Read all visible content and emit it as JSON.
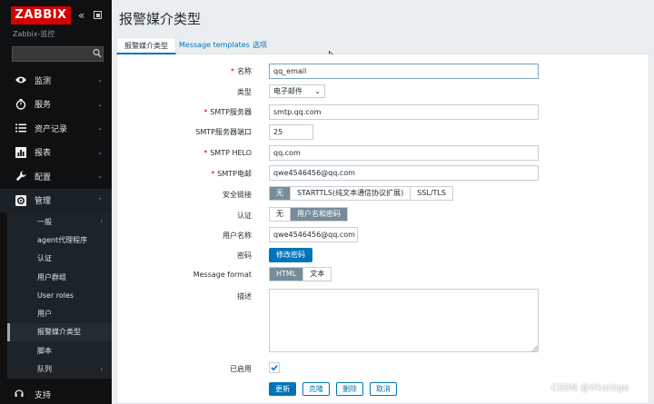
{
  "sidebar": {
    "logo": "ZABBIX",
    "subtitle": "Zabbix-监控",
    "search": {
      "value": "",
      "placeholder": ""
    },
    "items": [
      {
        "label": "监测",
        "icon": "eye-icon"
      },
      {
        "label": "服务",
        "icon": "clock-icon"
      },
      {
        "label": "资产记录",
        "icon": "list-icon"
      },
      {
        "label": "报表",
        "icon": "bar-chart-icon"
      },
      {
        "label": "配置",
        "icon": "wrench-icon"
      },
      {
        "label": "管理",
        "icon": "gear-icon"
      }
    ],
    "admin_items": [
      {
        "label": "一般"
      },
      {
        "label": "agent代理程序"
      },
      {
        "label": "认证"
      },
      {
        "label": "用户群组"
      },
      {
        "label": "User roles"
      },
      {
        "label": "用户"
      },
      {
        "label": "报警媒介类型"
      },
      {
        "label": "脚本"
      },
      {
        "label": "队列"
      }
    ],
    "support": "支持"
  },
  "header": {
    "title": "报警媒介类型"
  },
  "tabs": [
    {
      "label": "报警媒介类型"
    },
    {
      "label": "Message templates"
    },
    {
      "label": "选项"
    }
  ],
  "form": {
    "name": {
      "label": "名称",
      "value": "qq_email"
    },
    "type": {
      "label": "类型",
      "value": "电子邮件"
    },
    "smtp_server": {
      "label": "SMTP服务器",
      "value": "smtp.qq.com"
    },
    "smtp_port": {
      "label": "SMTP服务器端口",
      "value": "25"
    },
    "smtp_helo": {
      "label": "SMTP HELO",
      "value": "qq.com"
    },
    "smtp_email": {
      "label": "SMTP电邮",
      "value": "qwe4546456@qq.com"
    },
    "security": {
      "label": "安全链接",
      "options": [
        "无",
        "STARTTLS(纯文本通信协议扩展)",
        "SSL/TLS"
      ],
      "selected": "无"
    },
    "auth": {
      "label": "认证",
      "options": [
        "无",
        "用户名和密码"
      ],
      "selected": "用户名和密码"
    },
    "username": {
      "label": "用户名称",
      "value": "qwe4546456@qq.com"
    },
    "password": {
      "label": "密码",
      "button": "修改密码"
    },
    "message_format": {
      "label": "Message format",
      "options": [
        "HTML",
        "文本"
      ],
      "selected": "HTML"
    },
    "description": {
      "label": "描述",
      "value": ""
    },
    "enabled": {
      "label": "已启用",
      "checked": true
    }
  },
  "actions": {
    "update": "更新",
    "clone": "克隆",
    "delete": "删除",
    "cancel": "取消"
  },
  "watermark": "CSDN @#kaizige"
}
